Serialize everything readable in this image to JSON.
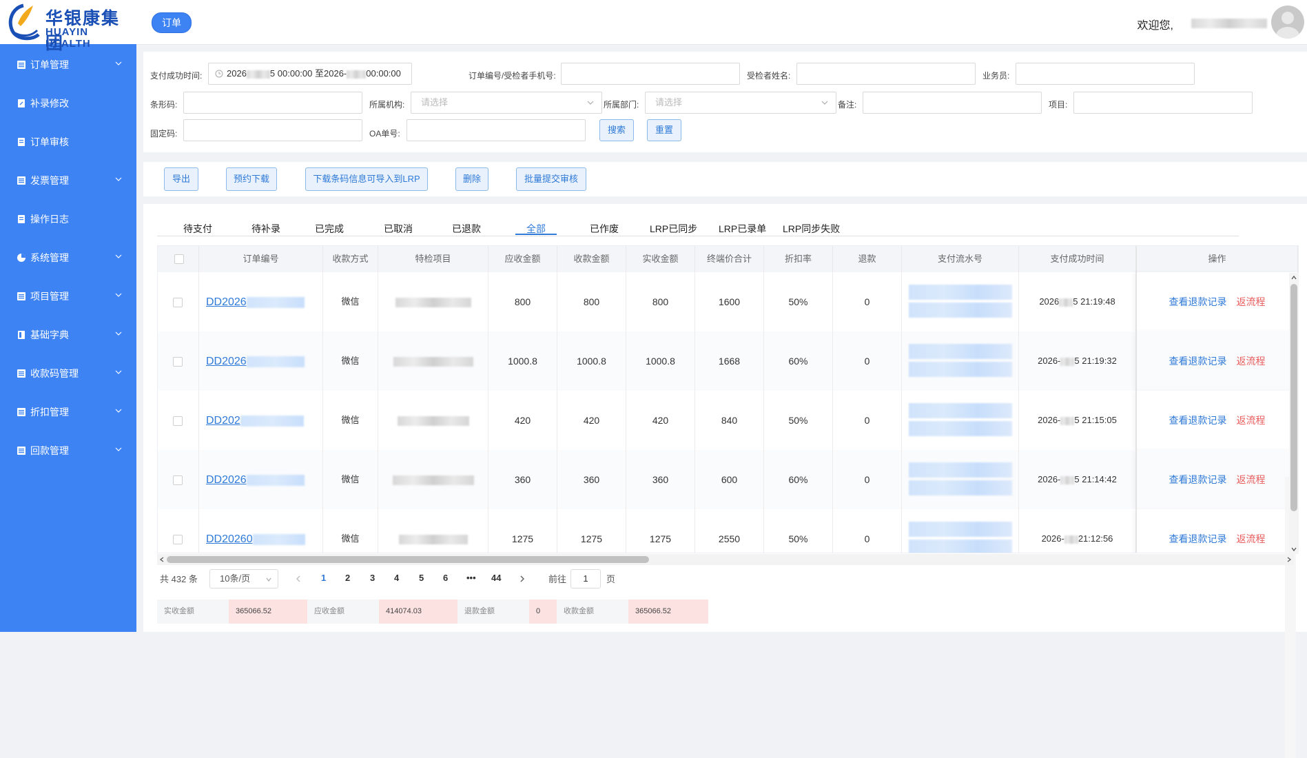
{
  "logo": {
    "cn": "华银康集团",
    "en": "HUAYIN HEALTH"
  },
  "topbar": {
    "tag": "订单",
    "welcome": "欢迎您,"
  },
  "sidebar": {
    "items": [
      {
        "label": "订单管理",
        "icon": "list-icon",
        "expandable": true
      },
      {
        "label": "补录修改",
        "icon": "edit-icon",
        "expandable": false
      },
      {
        "label": "订单审核",
        "icon": "doc-icon",
        "expandable": false
      },
      {
        "label": "发票管理",
        "icon": "list-icon",
        "expandable": true
      },
      {
        "label": "操作日志",
        "icon": "doc-icon",
        "expandable": false
      },
      {
        "label": "系统管理",
        "icon": "pie-icon",
        "expandable": true
      },
      {
        "label": "项目管理",
        "icon": "list-icon",
        "expandable": true
      },
      {
        "label": "基础字典",
        "icon": "book-icon",
        "expandable": true
      },
      {
        "label": "收款码管理",
        "icon": "list-icon",
        "expandable": true
      },
      {
        "label": "折扣管理",
        "icon": "list-icon",
        "expandable": true
      },
      {
        "label": "回款管理",
        "icon": "list-icon",
        "expandable": true
      }
    ]
  },
  "filters": {
    "pay_time_label": "支付成功时间:",
    "pay_time_start": "2026",
    "pay_time_start_suffix": "5 00:00:00",
    "pay_time_sep": "至",
    "pay_time_end": "2026-",
    "pay_time_end_suffix": "00:00:00",
    "order_no_label": "订单编号/受检者手机号:",
    "examinee_label": "受检者姓名:",
    "salesman_label": "业务员:",
    "barcode_label": "条形码:",
    "org_label": "所属机构:",
    "org_placeholder": "请选择",
    "dept_label": "所属部门:",
    "dept_placeholder": "请选择",
    "remark_label": "备注:",
    "project_label": "项目:",
    "fixed_code_label": "固定码:",
    "oa_label": "OA单号:",
    "search_btn": "搜索",
    "reset_btn": "重置"
  },
  "actions": [
    "导出",
    "预约下载",
    "下载条码信息可导入到LRP",
    "删除",
    "批量提交审核"
  ],
  "tabs": [
    "待支付",
    "待补录",
    "已完成",
    "已取消",
    "已退款",
    "全部",
    "已作废",
    "LRP已同步",
    "LRP已录单",
    "LRP同步失败"
  ],
  "active_tab": "全部",
  "table": {
    "headers": [
      "订单编号",
      "收款方式",
      "特检项目",
      "应收金额",
      "收款金额",
      "实收金额",
      "终端价合计",
      "折扣率",
      "退款",
      "支付流水号",
      "支付成功时间",
      "操作"
    ],
    "rows": [
      {
        "order": "DD2026",
        "method": "微信",
        "due": "800",
        "received": "800",
        "actual": "800",
        "terminal": "1600",
        "discount": "50%",
        "refund": "0",
        "time_a": "2026",
        "time_b": "5 21:19:48"
      },
      {
        "order": "DD2026",
        "method": "微信",
        "due": "1000.8",
        "received": "1000.8",
        "actual": "1000.8",
        "terminal": "1668",
        "discount": "60%",
        "refund": "0",
        "time_a": "2026-",
        "time_b": "5 21:19:32"
      },
      {
        "order": "DD202",
        "method": "微信",
        "due": "420",
        "received": "420",
        "actual": "420",
        "terminal": "840",
        "discount": "50%",
        "refund": "0",
        "time_a": "2026-",
        "time_b": "5 21:15:05"
      },
      {
        "order": "DD2026",
        "method": "微信",
        "due": "360",
        "received": "360",
        "actual": "360",
        "terminal": "600",
        "discount": "60%",
        "refund": "0",
        "time_a": "2026-",
        "time_b": "5 21:14:42"
      },
      {
        "order": "DD20260",
        "method": "微信",
        "due": "1275",
        "received": "1275",
        "actual": "1275",
        "terminal": "2550",
        "discount": "50%",
        "refund": "0",
        "time_a": "2026-",
        "time_b": "21:12:56"
      }
    ],
    "op_view": "查看退款记录",
    "op_return": "返流程"
  },
  "pager": {
    "total": "共 432 条",
    "page_size": "10条/页",
    "pages": [
      "1",
      "2",
      "3",
      "4",
      "5",
      "6",
      "•••",
      "44"
    ],
    "goto_label": "前往",
    "goto_value": "1",
    "page_suffix": "页"
  },
  "summary": [
    {
      "label": "实收金额",
      "value": "365066.52"
    },
    {
      "label": "应收金额",
      "value": "414074.03"
    },
    {
      "label": "退款金额",
      "value": "0"
    },
    {
      "label": "收款金额",
      "value": "365066.52"
    }
  ],
  "colors": {
    "sidebar": "#3d83f4",
    "accent": "#2f7ad8",
    "danger": "#e85a5a"
  }
}
